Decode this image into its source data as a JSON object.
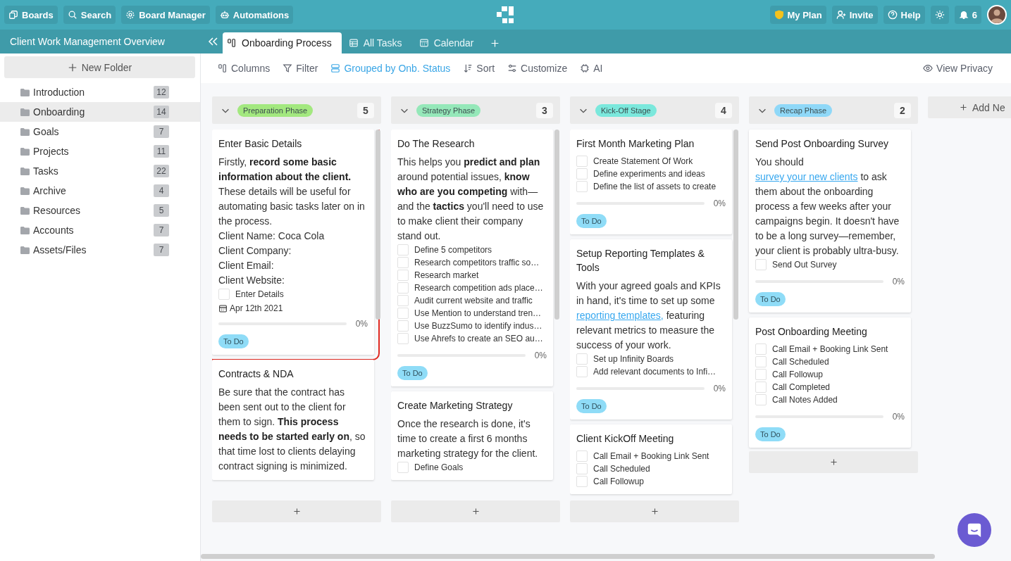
{
  "topbar": {
    "nav": [
      {
        "label": "Boards"
      },
      {
        "label": "Search"
      },
      {
        "label": "Board Manager"
      },
      {
        "label": "Automations"
      }
    ],
    "actions": [
      {
        "label": "My Plan"
      },
      {
        "label": "Invite"
      },
      {
        "label": "Help"
      }
    ],
    "notifications": {
      "count": "6"
    }
  },
  "sidebar": {
    "title": "Client Work Management Overview",
    "new_folder": "New Folder",
    "folders": [
      {
        "name": "Introduction",
        "count": "12",
        "selected": false
      },
      {
        "name": "Onboarding",
        "count": "14",
        "selected": true
      },
      {
        "name": "Goals",
        "count": "7",
        "selected": false
      },
      {
        "name": "Projects",
        "count": "11",
        "selected": false
      },
      {
        "name": "Tasks",
        "count": "22",
        "selected": false
      },
      {
        "name": "Archive",
        "count": "4",
        "selected": false
      },
      {
        "name": "Resources",
        "count": "5",
        "selected": false
      },
      {
        "name": "Accounts",
        "count": "7",
        "selected": false
      },
      {
        "name": "Assets/Files",
        "count": "7",
        "selected": false
      }
    ]
  },
  "tabs": [
    {
      "label": "Onboarding Process",
      "selected": true
    },
    {
      "label": "All Tasks",
      "selected": false
    },
    {
      "label": "Calendar",
      "selected": false
    }
  ],
  "toolbar": {
    "items": [
      {
        "label": "Columns",
        "active": false
      },
      {
        "label": "Filter",
        "active": false
      },
      {
        "label": "Grouped by Onb. Status",
        "active": true
      },
      {
        "label": "Sort",
        "active": false
      },
      {
        "label": "Customize",
        "active": false
      },
      {
        "label": "AI",
        "active": false
      }
    ],
    "view_privacy": "View Privacy"
  },
  "board": {
    "columns": [
      {
        "label": "Preparation Phase",
        "color": "#a3e87f",
        "count": "5",
        "scrollbar": true,
        "cards": [
          {
            "title": "Enter Basic Details",
            "highlighted": true,
            "body": [
              [
                {
                  "kind": "text",
                  "text": "Firstly, **record some basic information about the client.** These details will be useful for automating basic tasks later on in the process."
                }
              ]
            ],
            "lines": [
              "Client Name: Coca Cola",
              "Client Company:",
              "Client Email:",
              "Client Website:"
            ],
            "checklist": [
              {
                "label": "Enter Details",
                "checked": false
              }
            ],
            "date": "Apr 12th 2021",
            "level": 0,
            "percent": "0%",
            "status": "To Do"
          },
          {
            "title": "Contracts & NDA",
            "highlighted": false,
            "body": [
              [
                {
                  "kind": "text",
                  "text": "Be sure that the contract has been sent out to the client for them to sign. **This process needs to be started early on**, so that time lost to clients delaying contract signing is minimized."
                }
              ]
            ]
          }
        ]
      },
      {
        "label": "Strategy Phase",
        "color": "#95e8b9",
        "count": "3",
        "scrollbar": true,
        "cards": [
          {
            "title": "Do The Research",
            "highlighted": false,
            "body": [
              [
                {
                  "kind": "text",
                  "text": "This helps you **predict and plan** around potential issues, **know who are you competing** with—and the **tactics** you'll need to use to make client their company stand out."
                }
              ]
            ],
            "checklist": [
              {
                "label": "Define 5 competitors",
                "checked": false
              },
              {
                "label": "Research competitors traffic so…",
                "checked": false
              },
              {
                "label": "Research market",
                "checked": false
              },
              {
                "label": "Research competition ads place…",
                "checked": false
              },
              {
                "label": "Audit current website and traffic",
                "checked": false
              },
              {
                "label": "Use Mention to understand tren…",
                "checked": false
              },
              {
                "label": "Use BuzzSumo to identify indus…",
                "checked": false
              },
              {
                "label": "Use Ahrefs to create an SEO au…",
                "checked": false
              }
            ],
            "level": 0,
            "percent": "0%",
            "status": "To Do"
          },
          {
            "title": "Create Marketing Strategy",
            "highlighted": false,
            "body": [
              [
                {
                  "kind": "text",
                  "text": "Once the research is done, it's time to create a first 6 months marketing strategy for the client."
                }
              ]
            ],
            "checklist": [
              {
                "label": "Define Goals",
                "checked": false
              }
            ]
          }
        ]
      },
      {
        "label": "Kick-Off Stage",
        "color": "#7be8dc",
        "count": "4",
        "scrollbar": true,
        "cards": [
          {
            "title": "First Month Marketing Plan",
            "highlighted": false,
            "checklist": [
              {
                "label": "Create Statement Of Work",
                "checked": false
              },
              {
                "label": "Define experiments and ideas",
                "checked": false
              },
              {
                "label": "Define the list of assets to create",
                "checked": false
              }
            ],
            "level": 0,
            "percent": "0%",
            "status": "To Do"
          },
          {
            "title": "Setup Reporting Templates & Tools",
            "highlighted": false,
            "body": [
              [
                {
                  "kind": "text",
                  "text": "With your agreed goals and KPIs in hand, it's time to set up some"
                },
                {
                  "kind": "link",
                  "text": "reporting templates,"
                },
                {
                  "kind": "text",
                  "text": "featuring relevant metrics to measure the success of your work."
                }
              ]
            ],
            "checklist": [
              {
                "label": "Set up Infinity Boards",
                "checked": false
              },
              {
                "label": "Add relevant documents to Infi…",
                "checked": false
              }
            ],
            "level": 0,
            "percent": "0%",
            "status": "To Do"
          },
          {
            "title": "Client KickOff Meeting",
            "highlighted": false,
            "checklist": [
              {
                "label": "Call Email + Booking Link Sent",
                "checked": false
              },
              {
                "label": "Call Scheduled",
                "checked": false
              },
              {
                "label": "Call Followup",
                "checked": false
              }
            ]
          }
        ]
      },
      {
        "label": "Recap Phase",
        "color": "#8fd8f8",
        "count": "2",
        "scrollbar": false,
        "cards": [
          {
            "title": "Send Post Onboarding Survey",
            "highlighted": false,
            "body": [
              [
                {
                  "kind": "text",
                  "text": "You should"
                },
                {
                  "kind": "link",
                  "text": "survey your new clients"
                },
                {
                  "kind": "text",
                  "text": "to ask them about the onboarding process a few weeks after your campaigns begin. It doesn't have to be a long survey—remember, your client is probably ultra-busy."
                }
              ]
            ],
            "checklist": [
              {
                "label": "Send Out Survey",
                "checked": false
              }
            ],
            "level": 0,
            "percent": "0%",
            "status": "To Do"
          },
          {
            "title": "Post Onboarding Meeting",
            "highlighted": false,
            "checklist": [
              {
                "label": "Call Email + Booking Link Sent",
                "checked": false
              },
              {
                "label": "Call Scheduled",
                "checked": false
              },
              {
                "label": "Call Followup",
                "checked": false
              },
              {
                "label": "Call Completed",
                "checked": false
              },
              {
                "label": "Call Notes Added",
                "checked": false
              }
            ],
            "level": 0,
            "percent": "0%",
            "status": "To Do"
          }
        ]
      }
    ],
    "add_column": "Add Ne"
  }
}
